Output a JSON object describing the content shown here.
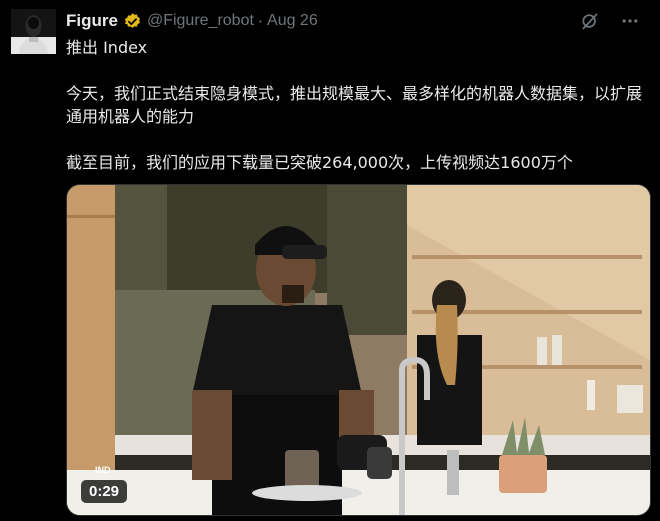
{
  "author": {
    "name": "Figure",
    "handle": "@Figure_robot",
    "separator": "·",
    "date": "Aug 26"
  },
  "tweet": {
    "line1": "推出 Index",
    "paragraph2": "今天，我们正式结束隐身模式，推出规模最大、最多样化的机器人数据集，以扩展通用机器人的能力",
    "paragraph3": "截至目前，我们的应用下载量已突破264,000次，上传视频达1600万个"
  },
  "media": {
    "duration": "0:29",
    "overlay_label": "IND"
  },
  "colors": {
    "background": "#000000",
    "text": "#e7e9ea",
    "muted": "#71767b",
    "verified_badge": "#e2b719"
  },
  "icons": [
    "verified-badge-icon",
    "grok-icon",
    "more-icon"
  ]
}
